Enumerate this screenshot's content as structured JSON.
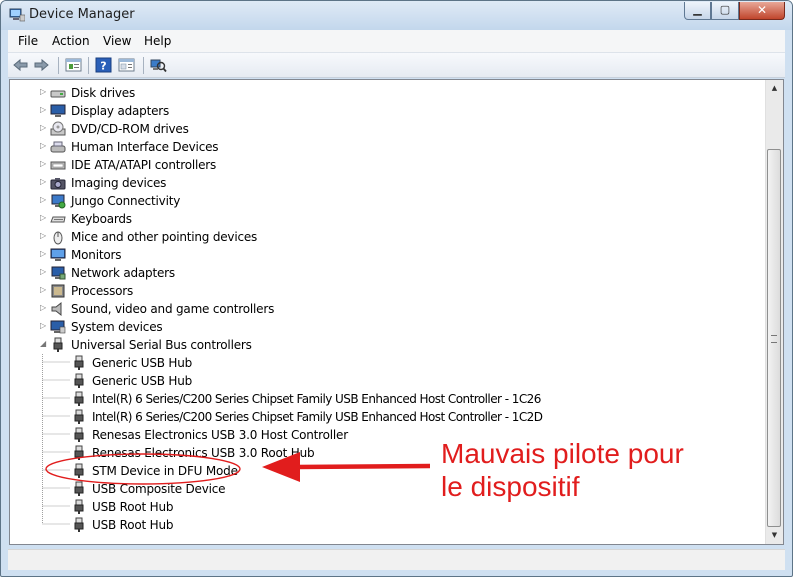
{
  "window": {
    "title": "Device Manager",
    "buttons": {
      "minimize": "▁",
      "maximize": "▢",
      "close": "✕"
    }
  },
  "menu": [
    "File",
    "Action",
    "View",
    "Help"
  ],
  "toolbar_icons": [
    "back-arrow-icon",
    "forward-arrow-icon",
    "properties-icon",
    "help-icon",
    "show-hide-console-tree-icon",
    "scan-hardware-icon"
  ],
  "tree": {
    "categories": [
      {
        "label": "Disk drives",
        "icon": "disk-drive-icon",
        "expanded": false
      },
      {
        "label": "Display adapters",
        "icon": "display-adapter-icon",
        "expanded": false
      },
      {
        "label": "DVD/CD-ROM drives",
        "icon": "dvd-drive-icon",
        "expanded": false
      },
      {
        "label": "Human Interface Devices",
        "icon": "hid-icon",
        "expanded": false
      },
      {
        "label": "IDE ATA/ATAPI controllers",
        "icon": "ide-controller-icon",
        "expanded": false
      },
      {
        "label": "Imaging devices",
        "icon": "camera-icon",
        "expanded": false
      },
      {
        "label": "Jungo Connectivity",
        "icon": "jungo-icon",
        "expanded": false
      },
      {
        "label": "Keyboards",
        "icon": "keyboard-icon",
        "expanded": false
      },
      {
        "label": "Mice and other pointing devices",
        "icon": "mouse-icon",
        "expanded": false
      },
      {
        "label": "Monitors",
        "icon": "monitor-icon",
        "expanded": false
      },
      {
        "label": "Network adapters",
        "icon": "network-adapter-icon",
        "expanded": false
      },
      {
        "label": "Processors",
        "icon": "processor-icon",
        "expanded": false
      },
      {
        "label": "Sound, video and game controllers",
        "icon": "speaker-icon",
        "expanded": false
      },
      {
        "label": "System devices",
        "icon": "system-devices-icon",
        "expanded": false
      },
      {
        "label": "Universal Serial Bus controllers",
        "icon": "usb-icon",
        "expanded": true
      }
    ],
    "usb_children": [
      "Generic USB Hub",
      "Generic USB Hub",
      "Intel(R) 6 Series/C200 Series Chipset Family USB Enhanced Host Controller - 1C26",
      "Intel(R) 6 Series/C200 Series Chipset Family USB Enhanced Host Controller - 1C2D",
      "Renesas Electronics USB 3.0 Host Controller",
      "Renesas Electronics USB 3.0 Root Hub",
      "STM Device in DFU Mode",
      "USB Composite Device",
      "USB Root Hub",
      "USB Root Hub"
    ]
  },
  "annotation": {
    "line1": "Mauvais pilote pour",
    "line2": "le dispositif",
    "color": "#e11d1d",
    "highlighted_item": "STM Device in DFU Mode"
  }
}
